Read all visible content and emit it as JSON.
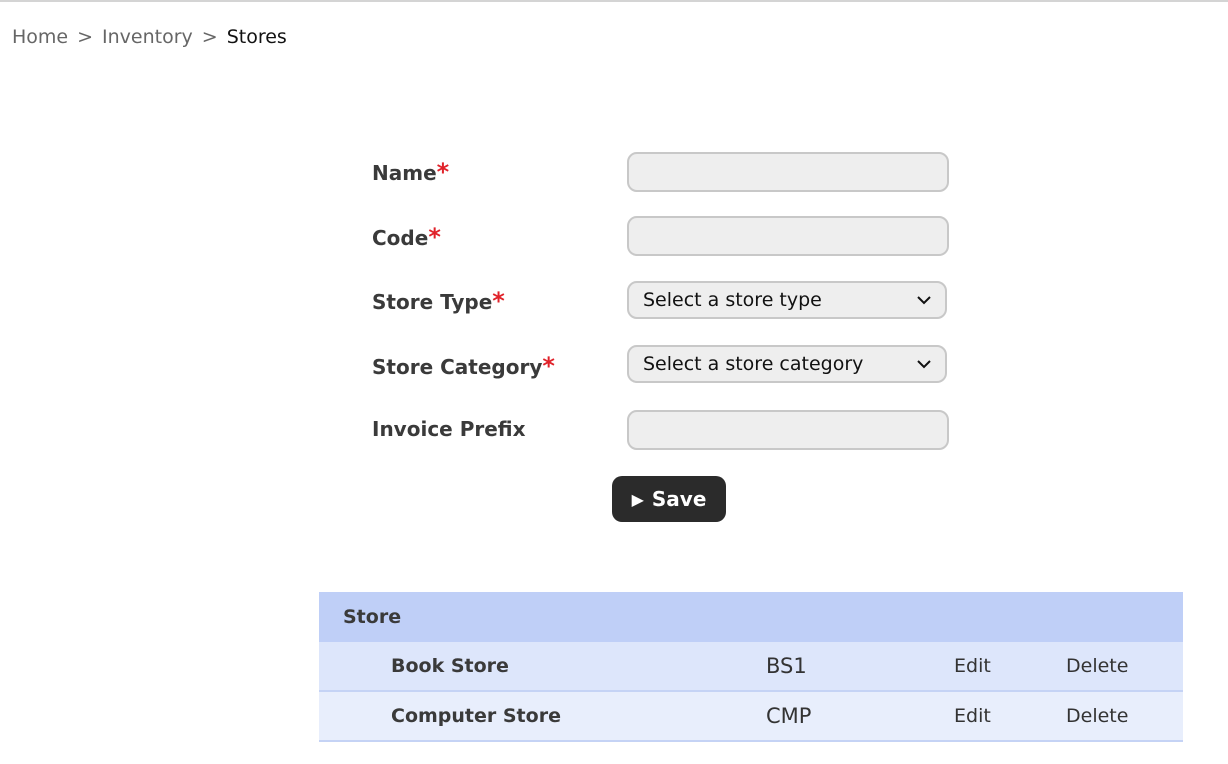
{
  "breadcrumb": {
    "home": "Home",
    "separator": ">",
    "inventory": "Inventory",
    "current": "Stores"
  },
  "form": {
    "required_mark": "*",
    "name_label": "Name",
    "name_value": "",
    "code_label": "Code",
    "code_value": "",
    "store_type_label": "Store Type",
    "store_type_value": "Select a store type",
    "store_category_label": "Store Category",
    "store_category_value": "Select a store category",
    "invoice_prefix_label": "Invoice Prefix",
    "invoice_prefix_value": "",
    "save_label": "Save",
    "save_icon": "play-icon"
  },
  "table": {
    "header": "Store",
    "rows": [
      {
        "name": "Book Store",
        "code": "BS1",
        "edit": "Edit",
        "delete": "Delete"
      },
      {
        "name": "Computer Store",
        "code": "CMP",
        "edit": "Edit",
        "delete": "Delete"
      }
    ]
  },
  "colors": {
    "required": "#e0222a",
    "button_bg": "#2b2b2b",
    "table_header_bg": "#bfcff7",
    "row_bg": "#dde6fb"
  }
}
